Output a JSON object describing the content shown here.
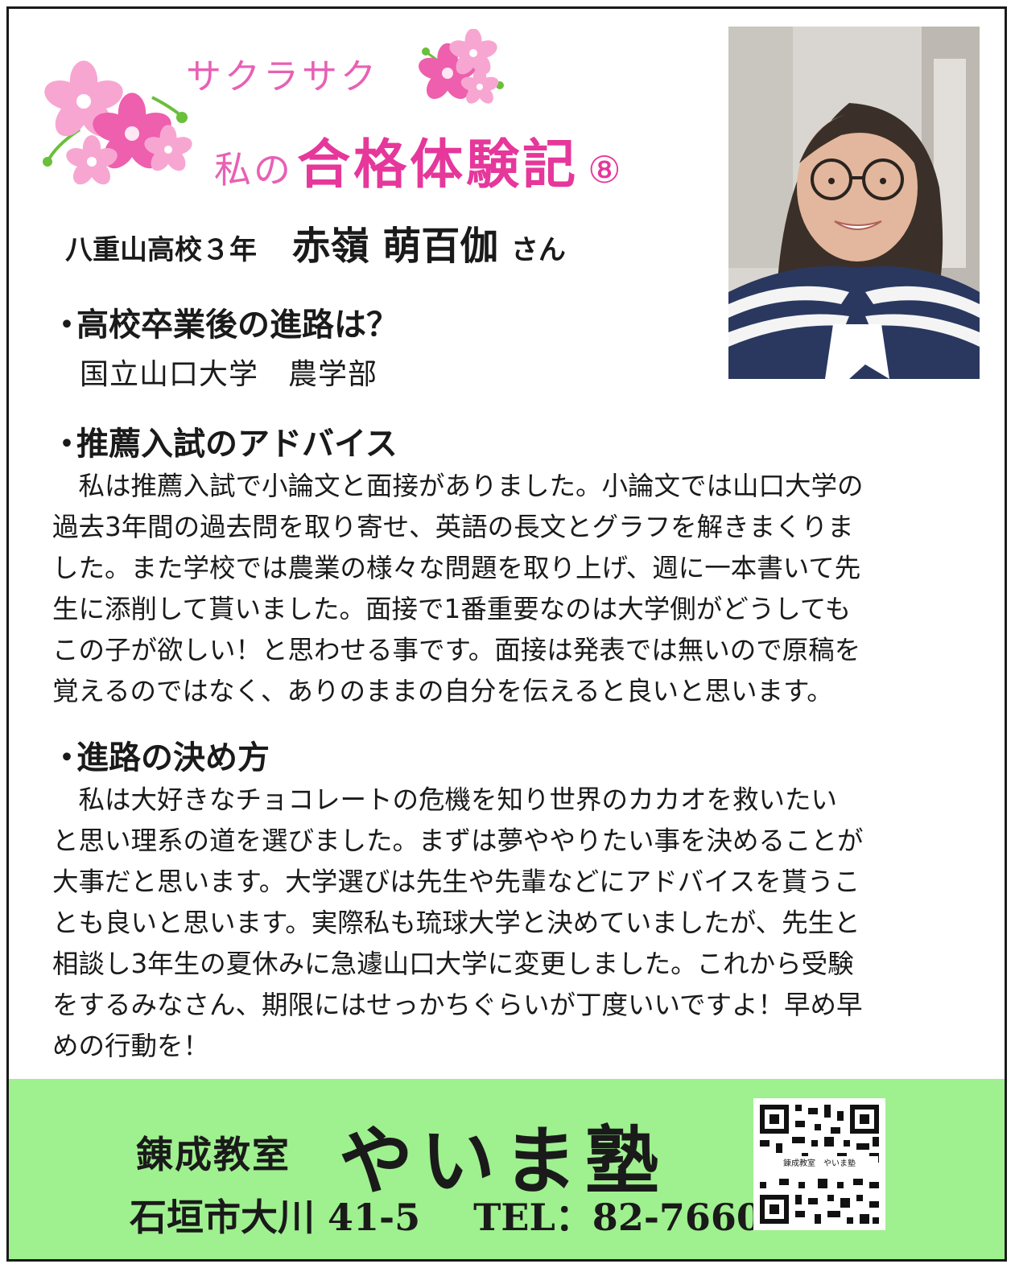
{
  "header": {
    "subtitle": "サクラサク",
    "title_prefix": "私の",
    "title": "合格体験記",
    "number": "⑧"
  },
  "profile": {
    "school_grade": "八重山高校３年",
    "name": "赤嶺 萌百伽",
    "suffix": "さん"
  },
  "sections": [
    {
      "question": "高校卒業後の進路は？",
      "answer": "国立山口大学　農学部"
    },
    {
      "question": "推薦入試のアドバイス",
      "lines": [
        "　私は推薦入試で小論文と面接がありました。小論文では山口大学の",
        "過去3年間の過去問を取り寄せ、英語の長文とグラフを解きまくりま",
        "した。また学校では農業の様々な問題を取り上げ、週に一本書いて先",
        "生に添削して貰いました。面接で1番重要なのは大学側がどうしても",
        "この子が欲しい！と思わせる事です。面接は発表では無いので原稿を",
        "覚えるのではなく、ありのままの自分を伝えると良いと思います。"
      ]
    },
    {
      "question": "進路の決め方",
      "lines": [
        "　私は大好きなチョコレートの危機を知り世界のカカオを救いたい",
        "と思い理系の道を選びました。まずは夢ややりたい事を決めることが",
        "大事だと思います。大学選びは先生や先輩などにアドバイスを貰うこ",
        "とも良いと思います。実際私も琉球大学と決めていましたが、先生と",
        "相談し3年生の夏休みに急遽山口大学に変更しました。これから受験",
        "をするみなさん、期限にはせっかちぐらいが丁度いいですよ！早め早",
        "めの行動を！"
      ]
    }
  ],
  "footer": {
    "school_label": "錬成教室",
    "school_name": "やいま塾",
    "address": "石垣市大川 41-5",
    "tel": "TEL：82-7660",
    "qr_caption": "錬成教室　やいま塾"
  },
  "colors": {
    "title_pink": "#e6379b",
    "subtitle_pink": "#e860b4",
    "footer_green": "#9ff08f",
    "text": "#1a1a1a"
  },
  "icons": [
    "sakura-flower-icon",
    "qr-code"
  ]
}
